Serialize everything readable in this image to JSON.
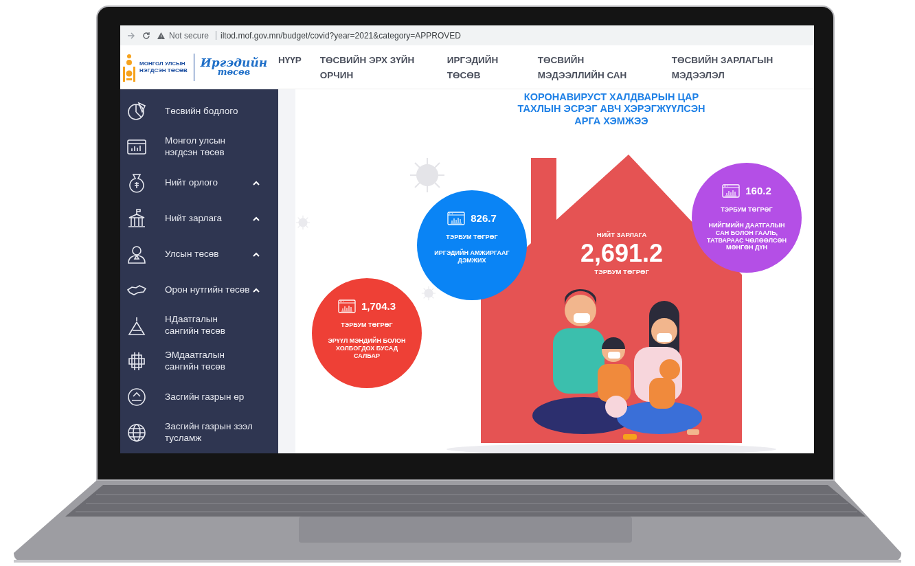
{
  "browser": {
    "security": "Not secure",
    "url": "iltod.mof.gov.mn/budget/covid?year=2021&category=APPROVED"
  },
  "logo": {
    "org_line_1": "МОНГОЛ УЛСЫН",
    "org_line_2": "НЭГДСЭН ТӨСӨВ",
    "script_line_1": "Иргэдийн",
    "script_line_2": "төсөв"
  },
  "nav": [
    "НҮҮР",
    "ТӨСВИЙН ЭРХ ЗҮЙН ОРЧИН",
    "ИРГЭДИЙН ТӨСӨВ",
    "ТӨСВИЙН МЭДЭЭЛЛИЙН САН",
    "ТӨСВИЙН ЗАРЛАГЫН МЭДЭЭЛЭЛ"
  ],
  "sidebar": {
    "items": [
      {
        "label": "Төсвийн бодлого",
        "expandable": false
      },
      {
        "label": "Монгол улсын нэгдсэн төсөв",
        "expandable": false
      },
      {
        "label": "Нийт орлого",
        "expandable": true
      },
      {
        "label": "Нийт зарлага",
        "expandable": true
      },
      {
        "label": "Улсын төсөв",
        "expandable": true
      },
      {
        "label": "Орон нутгийн төсөв",
        "expandable": true
      },
      {
        "label": "НДаатгалын сангийн төсөв",
        "expandable": false
      },
      {
        "label": "ЭМдаатгалын сангийн төсөв",
        "expandable": false
      },
      {
        "label": "Засгийн газрын өр",
        "expandable": false
      },
      {
        "label": "Засгийн газрын зээл тусламж",
        "expandable": false
      }
    ]
  },
  "infographic": {
    "title": "КОРОНАВИРУСТ ХАЛДВАРЫН ЦАР ТАХЛЫН ЭСРЭГ АВЧ ХЭРЭГЖҮҮЛСЭН АРГА ХЭМЖЭЭ",
    "total": {
      "label": "НИЙТ ЗАРЛАГА",
      "value": "2,691.2",
      "unit": "ТЭРБУМ ТӨГРӨГ"
    },
    "bubbles": [
      {
        "value": "160.2",
        "unit": "ТЭРБУМ ТӨГРӨГ",
        "description": "НИЙГМИЙН ДААТГАЛЫН САН БОЛОН ГААЛЬ, ТАТВАРААС ЧӨЛӨӨЛСӨН МӨНГӨН ДҮН",
        "color": "#b44fe6"
      },
      {
        "value": "826.7",
        "unit": "ТЭРБУМ ТӨГРӨГ",
        "description": "ИРГЭДИЙН АМЖИРГААГ ДЭМЖИХ",
        "color": "#0a84f5"
      },
      {
        "value": "1,704.3",
        "unit": "ТЭРБУМ ТӨГРӨГ",
        "description": "ЭРҮҮЛ МЭНДИЙН БОЛОН ХОЛБОГДОХ БУСАД САЛБАР",
        "color": "#ee4036"
      }
    ]
  }
}
